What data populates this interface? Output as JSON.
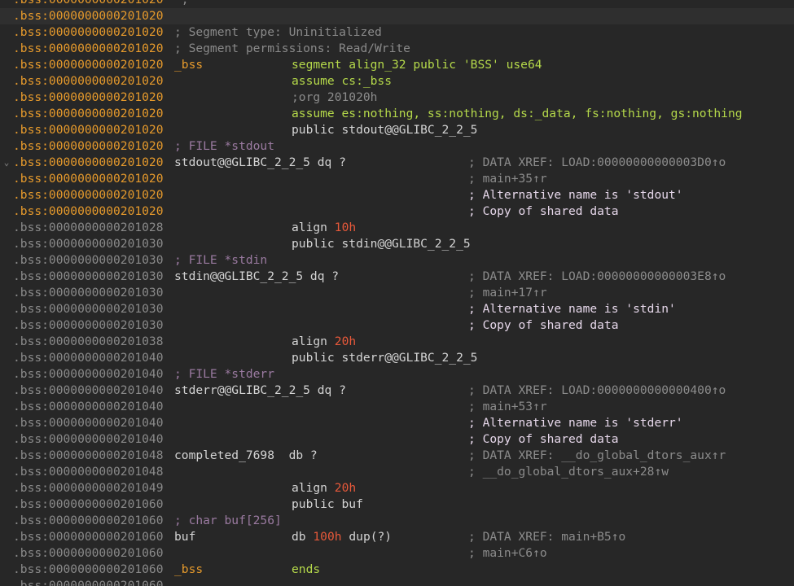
{
  "colors": {
    "addr_named": "#e69a2c",
    "addr_plain": "#8a8a8a",
    "text": "#d4d4d4",
    "keyword": "#b5d94a",
    "number": "#e8593a",
    "comment": "#8c8c8c",
    "comment_repeat": "#e6d7ea",
    "segment_comment": "#8a8a8a",
    "file_comment": "#9a7aa0",
    "background": "#272727"
  },
  "lines": [
    {
      "addr": ".bss:0000000000201020",
      "named": true,
      "parts": [
        {
          "t": " ;",
          "c": "comment",
          "x": "lbl"
        }
      ]
    },
    {
      "addr": ".bss:0000000000201020",
      "named": true,
      "hl": true,
      "parts": []
    },
    {
      "addr": ".bss:0000000000201020",
      "named": true,
      "parts": [
        {
          "t": "; Segment type: Uninitialized",
          "c": "segment_comment",
          "x": "fcmt"
        }
      ]
    },
    {
      "addr": ".bss:0000000000201020",
      "named": true,
      "parts": [
        {
          "t": "; Segment permissions: Read/Write",
          "c": "segment_comment",
          "x": "fcmt"
        }
      ]
    },
    {
      "addr": ".bss:0000000000201020",
      "named": true,
      "parts": [
        {
          "t": "_bss",
          "c": "addr_named",
          "x": "lbl"
        },
        {
          "t": "segment align_32 public 'BSS' use64",
          "c": "keyword",
          "x": "ins"
        }
      ]
    },
    {
      "addr": ".bss:0000000000201020",
      "named": true,
      "parts": [
        {
          "t": "assume cs:_bss",
          "c": "keyword",
          "x": "ins"
        }
      ]
    },
    {
      "addr": ".bss:0000000000201020",
      "named": true,
      "parts": [
        {
          "t": ";org 201020h",
          "c": "comment",
          "x": "ins"
        }
      ]
    },
    {
      "addr": ".bss:0000000000201020",
      "named": true,
      "parts": [
        {
          "t": "assume es:nothing, ss:nothing, ds:_data, fs:nothing, gs:nothing",
          "c": "keyword",
          "x": "ins"
        }
      ]
    },
    {
      "addr": ".bss:0000000000201020",
      "named": true,
      "parts": [
        {
          "t": "public stdout@@GLIBC_2_2_5",
          "c": "text",
          "x": "ins"
        }
      ]
    },
    {
      "addr": ".bss:0000000000201020",
      "named": true,
      "parts": [
        {
          "t": "; FILE *stdout",
          "c": "file_comment",
          "x": "fcmt"
        }
      ]
    },
    {
      "addr": ".bss:0000000000201020",
      "named": true,
      "gutter": "⌄",
      "parts": [
        {
          "t": "stdout@@GLIBC_2_2_5 dq ?",
          "c": "text",
          "x": "lbl"
        },
        {
          "t": "; DATA XREF: LOAD:00000000000003D0↑o",
          "c": "comment",
          "x": "cmt"
        }
      ]
    },
    {
      "addr": ".bss:0000000000201020",
      "named": true,
      "parts": [
        {
          "t": "; main+35↑r",
          "c": "comment",
          "x": "cmt"
        }
      ]
    },
    {
      "addr": ".bss:0000000000201020",
      "named": true,
      "parts": [
        {
          "t": "; Alternative name is 'stdout'",
          "c": "comment_repeat",
          "x": "cmt"
        }
      ]
    },
    {
      "addr": ".bss:0000000000201020",
      "named": true,
      "parts": [
        {
          "t": "; Copy of shared data",
          "c": "comment_repeat",
          "x": "cmt"
        }
      ]
    },
    {
      "addr": ".bss:0000000000201028",
      "named": false,
      "parts": [
        {
          "t": "align ",
          "c": "text",
          "x": "ins"
        },
        {
          "t": "10h",
          "c": "number",
          "x": "ins2"
        }
      ]
    },
    {
      "addr": ".bss:0000000000201030",
      "named": false,
      "parts": [
        {
          "t": "public stdin@@GLIBC_2_2_5",
          "c": "text",
          "x": "ins"
        }
      ]
    },
    {
      "addr": ".bss:0000000000201030",
      "named": false,
      "parts": [
        {
          "t": "; FILE *stdin",
          "c": "file_comment",
          "x": "fcmt"
        }
      ]
    },
    {
      "addr": ".bss:0000000000201030",
      "named": false,
      "parts": [
        {
          "t": "stdin@@GLIBC_2_2_5 dq ?",
          "c": "text",
          "x": "lbl"
        },
        {
          "t": "; DATA XREF: LOAD:00000000000003E8↑o",
          "c": "comment",
          "x": "cmt"
        }
      ]
    },
    {
      "addr": ".bss:0000000000201030",
      "named": false,
      "parts": [
        {
          "t": "; main+17↑r",
          "c": "comment",
          "x": "cmt"
        }
      ]
    },
    {
      "addr": ".bss:0000000000201030",
      "named": false,
      "parts": [
        {
          "t": "; Alternative name is 'stdin'",
          "c": "comment_repeat",
          "x": "cmt"
        }
      ]
    },
    {
      "addr": ".bss:0000000000201030",
      "named": false,
      "parts": [
        {
          "t": "; Copy of shared data",
          "c": "comment_repeat",
          "x": "cmt"
        }
      ]
    },
    {
      "addr": ".bss:0000000000201038",
      "named": false,
      "parts": [
        {
          "t": "align ",
          "c": "text",
          "x": "ins"
        },
        {
          "t": "20h",
          "c": "number",
          "x": "ins2"
        }
      ]
    },
    {
      "addr": ".bss:0000000000201040",
      "named": false,
      "parts": [
        {
          "t": "public stderr@@GLIBC_2_2_5",
          "c": "text",
          "x": "ins"
        }
      ]
    },
    {
      "addr": ".bss:0000000000201040",
      "named": false,
      "parts": [
        {
          "t": "; FILE *stderr",
          "c": "file_comment",
          "x": "fcmt"
        }
      ]
    },
    {
      "addr": ".bss:0000000000201040",
      "named": false,
      "parts": [
        {
          "t": "stderr@@GLIBC_2_2_5 dq ?",
          "c": "text",
          "x": "lbl"
        },
        {
          "t": "; DATA XREF: LOAD:0000000000000400↑o",
          "c": "comment",
          "x": "cmt"
        }
      ]
    },
    {
      "addr": ".bss:0000000000201040",
      "named": false,
      "parts": [
        {
          "t": "; main+53↑r",
          "c": "comment",
          "x": "cmt"
        }
      ]
    },
    {
      "addr": ".bss:0000000000201040",
      "named": false,
      "parts": [
        {
          "t": "; Alternative name is 'stderr'",
          "c": "comment_repeat",
          "x": "cmt"
        }
      ]
    },
    {
      "addr": ".bss:0000000000201040",
      "named": false,
      "parts": [
        {
          "t": "; Copy of shared data",
          "c": "comment_repeat",
          "x": "cmt"
        }
      ]
    },
    {
      "addr": ".bss:0000000000201048",
      "named": false,
      "parts": [
        {
          "t": "completed_7698  db ?",
          "c": "text",
          "x": "lbl"
        },
        {
          "t": "; DATA XREF: __do_global_dtors_aux↑r",
          "c": "comment",
          "x": "cmt"
        }
      ]
    },
    {
      "addr": ".bss:0000000000201048",
      "named": false,
      "parts": [
        {
          "t": "; __do_global_dtors_aux+28↑w",
          "c": "comment",
          "x": "cmt"
        }
      ]
    },
    {
      "addr": ".bss:0000000000201049",
      "named": false,
      "parts": [
        {
          "t": "align ",
          "c": "text",
          "x": "ins"
        },
        {
          "t": "20h",
          "c": "number",
          "x": "ins2"
        }
      ]
    },
    {
      "addr": ".bss:0000000000201060",
      "named": false,
      "parts": [
        {
          "t": "public buf",
          "c": "text",
          "x": "ins"
        }
      ]
    },
    {
      "addr": ".bss:0000000000201060",
      "named": false,
      "parts": [
        {
          "t": "; char buf[256]",
          "c": "file_comment",
          "x": "fcmt"
        }
      ]
    },
    {
      "addr": ".bss:0000000000201060",
      "named": false,
      "parts": [
        {
          "t": "buf",
          "c": "text",
          "x": "lbl"
        },
        {
          "t": "db ",
          "c": "text",
          "x": "ins"
        },
        {
          "t": "100h",
          "c": "number",
          "x": "ins3"
        },
        {
          "t": " dup(?)",
          "c": "text",
          "x": "ins4"
        },
        {
          "t": "; DATA XREF: main+B5↑o",
          "c": "comment",
          "x": "cmt"
        }
      ]
    },
    {
      "addr": ".bss:0000000000201060",
      "named": false,
      "parts": [
        {
          "t": "; main+C6↑o",
          "c": "comment",
          "x": "cmt"
        }
      ]
    },
    {
      "addr": ".bss:0000000000201060",
      "named": false,
      "parts": [
        {
          "t": "_bss",
          "c": "addr_named",
          "x": "lbl"
        },
        {
          "t": "ends",
          "c": "keyword",
          "x": "ins"
        }
      ]
    },
    {
      "addr": ".bss:0000000000201060",
      "named": false,
      "parts": []
    }
  ]
}
